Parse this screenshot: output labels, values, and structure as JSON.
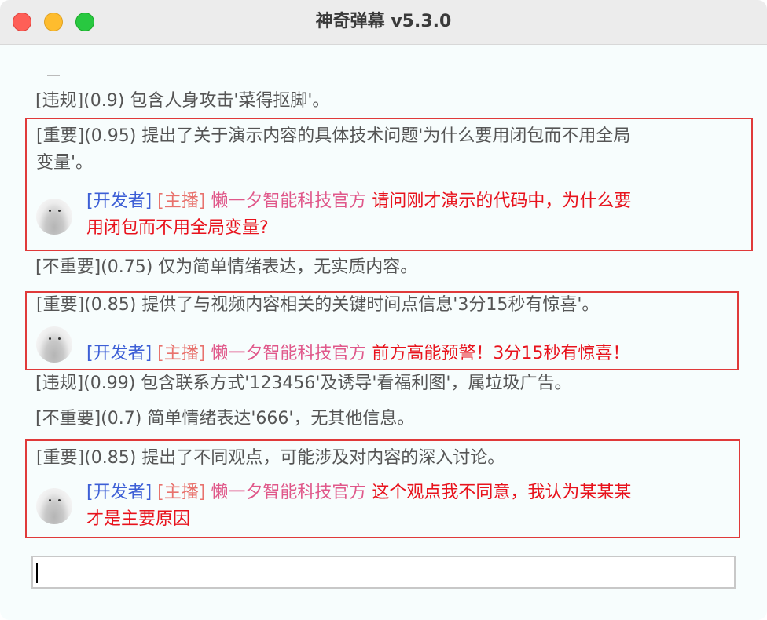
{
  "window": {
    "title": "神奇弹幕 v5.3.0"
  },
  "feed": {
    "lines": [
      {
        "text": "[违规](0.9) 包含人身攻击'菜得抠脚'。"
      },
      {
        "text": "[不重要](0.75) 仅为简单情绪表达，无实质内容。"
      },
      {
        "text": "[违规](0.99) 包含联系方式'123456'及诱导'看福利图'，属垃圾广告。"
      },
      {
        "text": "[不重要](0.7) 简单情绪表达'666'，无其他信息。"
      }
    ],
    "highlights": [
      {
        "analysis_line1": "[重要](0.95) 提出了关于演示内容的具体技术问题'为什么要用闭包而不用全局",
        "analysis_line2": "变量'。",
        "role_dev": "[开发者]",
        "role_host": "[主播]",
        "username": "懒一夕智能科技官方",
        "message_line1": "请问刚才演示的代码中，为什么要",
        "message_line2": "用闭包而不用全局变量?"
      },
      {
        "analysis_line1": "[重要](0.85) 提供了与视频内容相关的关键时间点信息'3分15秒有惊喜'。",
        "role_dev": "[开发者]",
        "role_host": "[主播]",
        "username": "懒一夕智能科技官方",
        "message_line1": "前方高能预警！3分15秒有惊喜！"
      },
      {
        "analysis_line1": "[重要](0.85) 提出了不同观点，可能涉及对内容的深入讨论。",
        "role_dev": "[开发者]",
        "role_host": "[主播]",
        "username": "懒一夕智能科技官方",
        "message_line1": "这个观点我不同意，我认为某某某",
        "message_line2": "才是主要原因"
      }
    ]
  },
  "input": {
    "value": ""
  },
  "colors": {
    "highlight_border": "#e03a3a",
    "role_dev": "#3d5fd6",
    "role_host": "#e8726d",
    "username": "#e0588a",
    "message": "#e8121c"
  }
}
